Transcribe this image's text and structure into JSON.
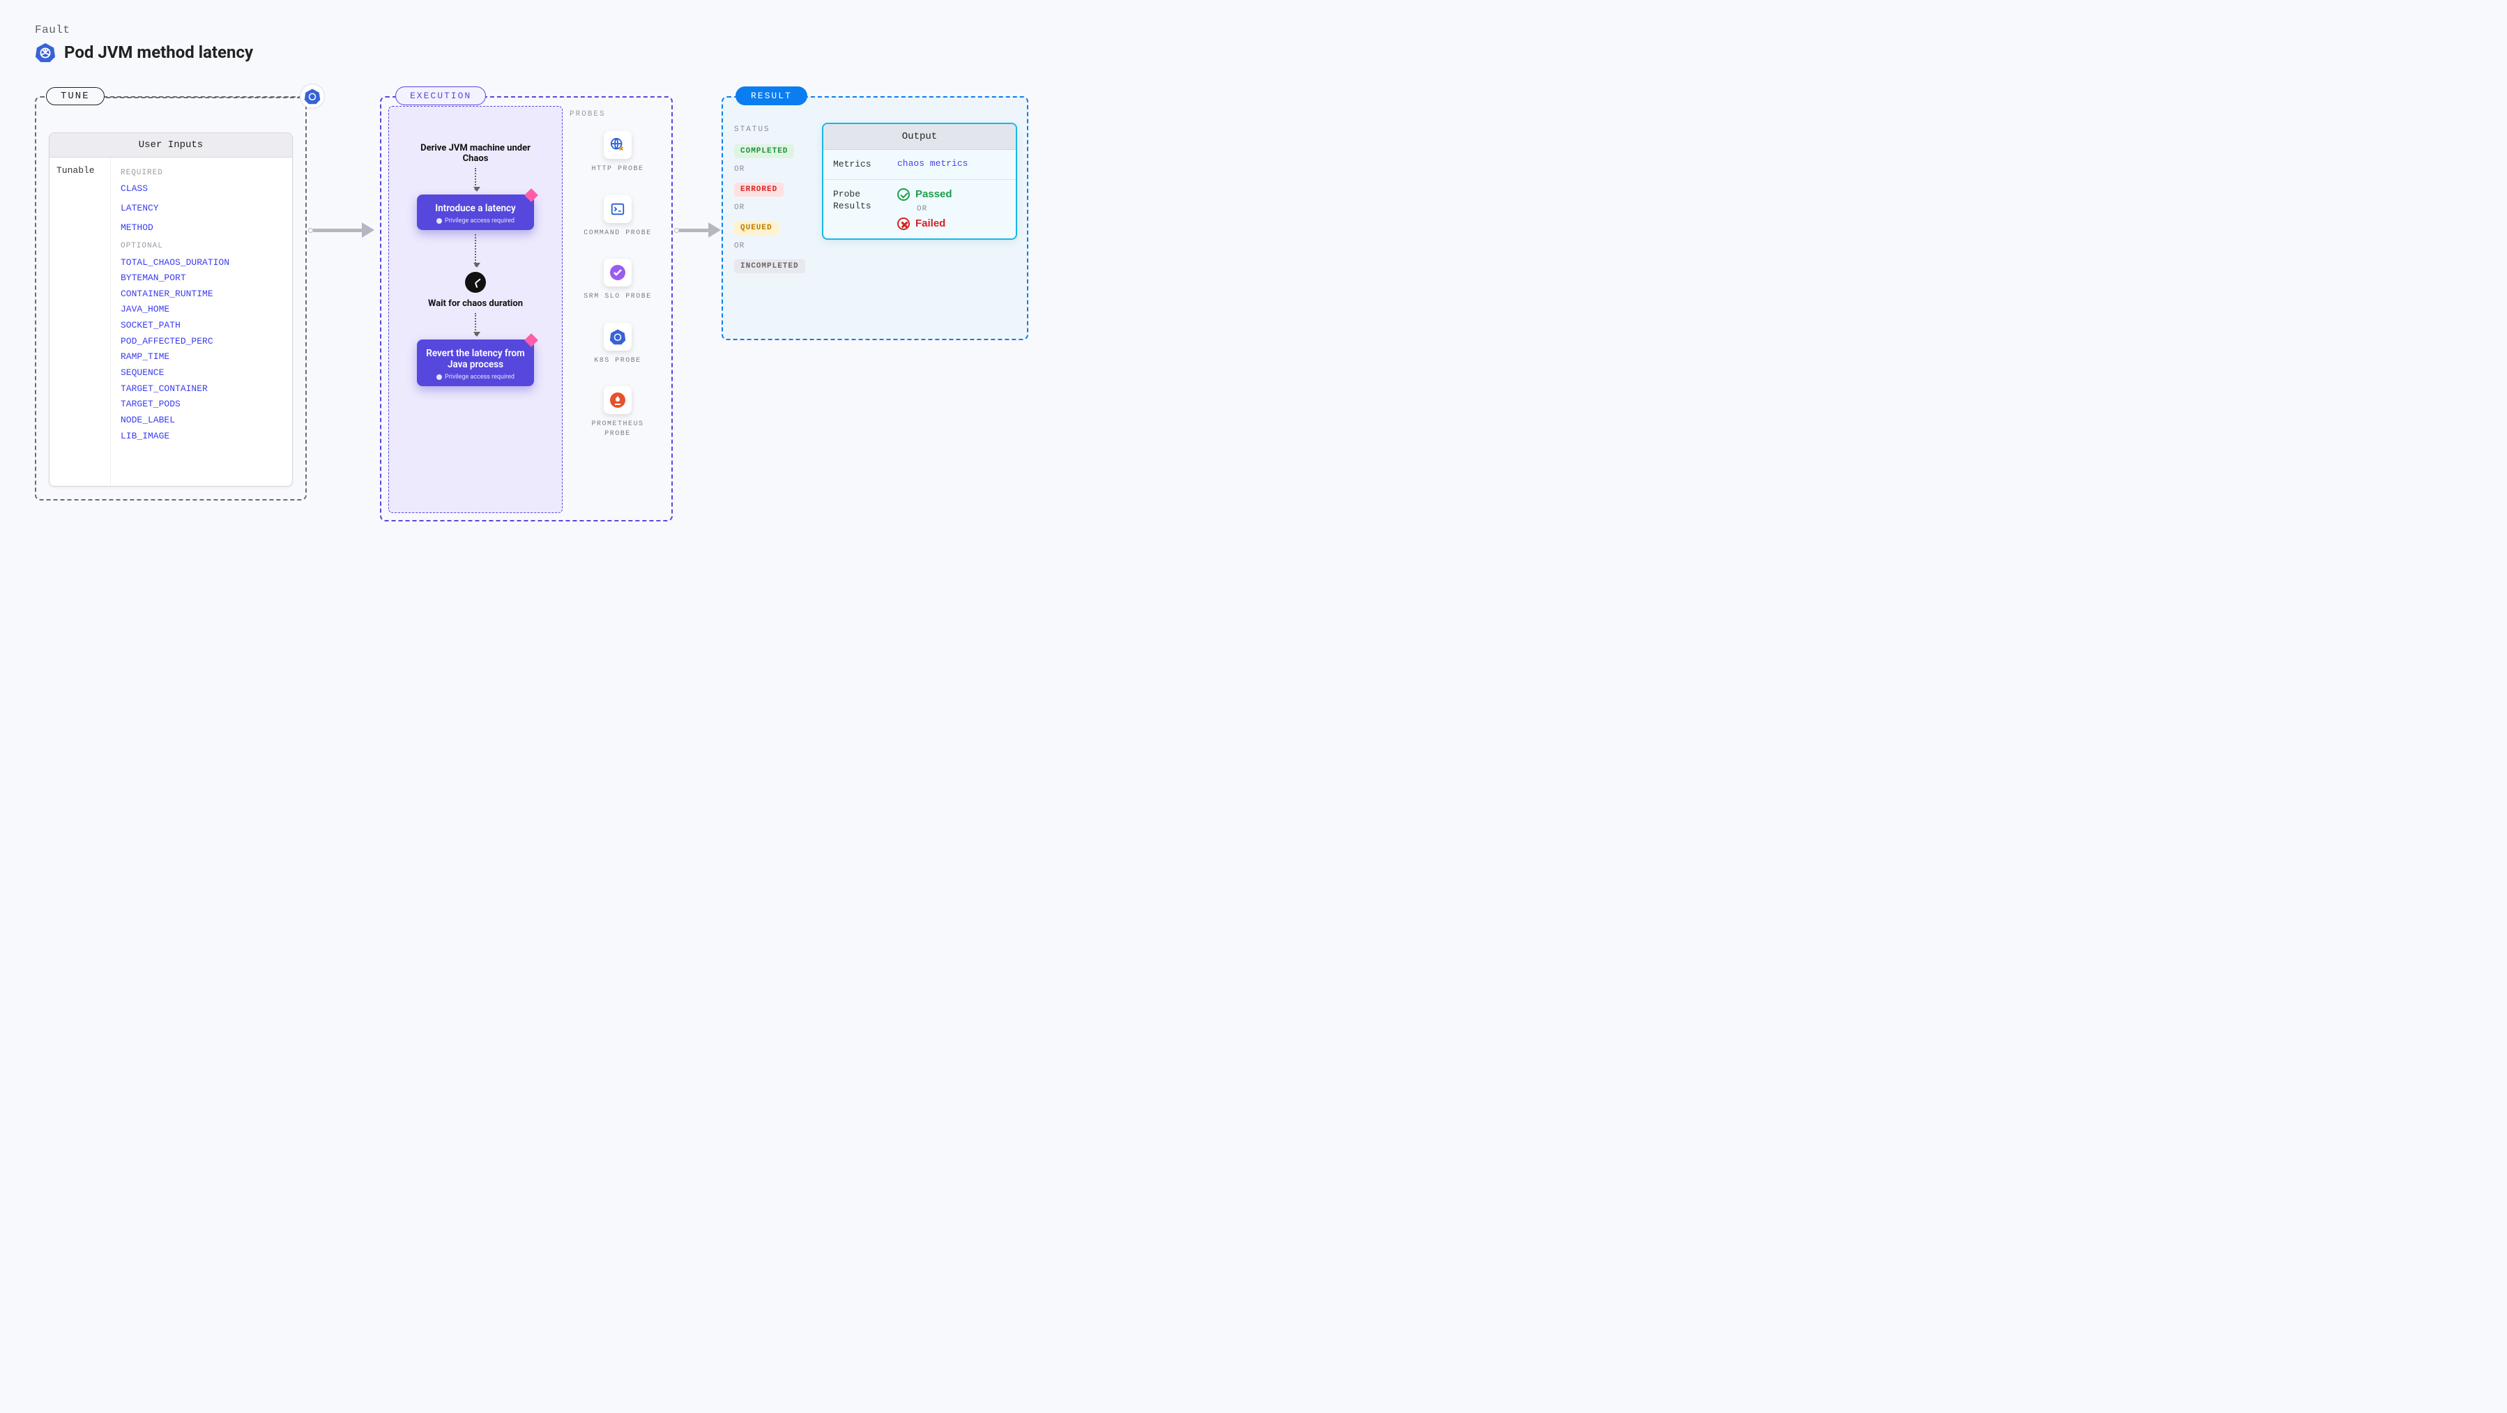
{
  "header": {
    "kicker": "Fault",
    "title": "Pod JVM method latency"
  },
  "tune": {
    "tab": "TUNE",
    "card_title": "User Inputs",
    "side_label": "Tunable",
    "required_label": "REQUIRED",
    "optional_label": "OPTIONAL",
    "required": [
      "CLASS",
      "LATENCY",
      "METHOD"
    ],
    "optional": [
      "TOTAL_CHAOS_DURATION",
      "BYTEMAN_PORT",
      "CONTAINER_RUNTIME",
      "JAVA_HOME",
      "SOCKET_PATH",
      "POD_AFFECTED_PERC",
      "RAMP_TIME",
      "SEQUENCE",
      "TARGET_CONTAINER",
      "TARGET_PODS",
      "NODE_LABEL",
      "LIB_IMAGE"
    ]
  },
  "execution": {
    "tab": "EXECUTION",
    "step1": "Derive JVM machine under Chaos",
    "card1_title": "Introduce a latency",
    "card_priv": "Privilege access required",
    "step2": "Wait for chaos duration",
    "card2_title": "Revert the latency from Java process",
    "probes_label": "PROBES",
    "probes": [
      {
        "label": "HTTP PROBE",
        "icon": "globe"
      },
      {
        "label": "COMMAND PROBE",
        "icon": "prompt"
      },
      {
        "label": "SRM SLO PROBE",
        "icon": "slo"
      },
      {
        "label": "K8S PROBE",
        "icon": "k8s"
      },
      {
        "label": "PROMETHEUS PROBE",
        "icon": "prom"
      }
    ]
  },
  "result": {
    "tab": "RESULT",
    "status_label": "STATUS",
    "or": "OR",
    "statuses": {
      "completed": "COMPLETED",
      "errored": "ERRORED",
      "queued": "QUEUED",
      "incompleted": "INCOMPLETED"
    },
    "output": {
      "title": "Output",
      "metrics_key": "Metrics",
      "metrics_val": "chaos metrics",
      "probe_key": "Probe Results",
      "passed": "Passed",
      "failed": "Failed"
    }
  }
}
